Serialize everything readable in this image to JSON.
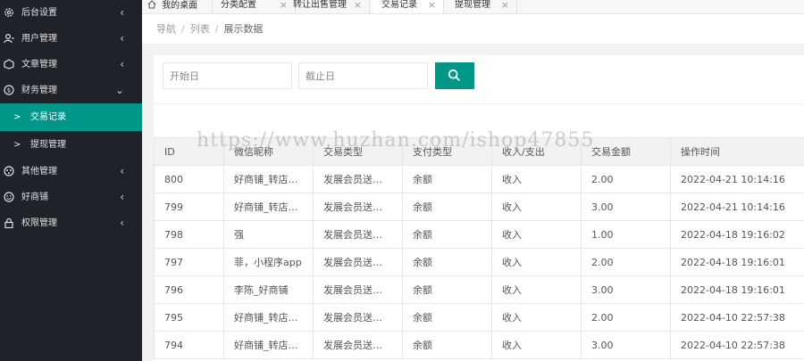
{
  "sidebar": {
    "items": [
      {
        "label": "后台设置",
        "icon": "gear-icon",
        "arrow": "‹"
      },
      {
        "label": "用户管理",
        "icon": "user-icon",
        "arrow": "‹"
      },
      {
        "label": "文章管理",
        "icon": "article-icon",
        "arrow": "‹"
      },
      {
        "label": "财务管理",
        "icon": "finance-icon",
        "arrow": "⌄"
      },
      {
        "label": "其他管理",
        "icon": "other-icon",
        "arrow": "‹"
      },
      {
        "label": "好商铺",
        "icon": "smile-icon",
        "arrow": "‹"
      },
      {
        "label": "权限管理",
        "icon": "lock-icon",
        "arrow": "‹"
      }
    ],
    "sub_items": [
      {
        "label": "交易记录",
        "arrow": ">"
      },
      {
        "label": "提现管理",
        "arrow": ">"
      }
    ],
    "active_color": "#009688",
    "bg_color": "#20222a"
  },
  "tabs": [
    {
      "label": "我的桌面",
      "icon": "home-icon"
    },
    {
      "label": "分类配置",
      "close": "×"
    },
    {
      "label": "转让出售管理",
      "close": "×"
    },
    {
      "label": "交易记录",
      "close": "×"
    },
    {
      "label": "提现管理",
      "close": "×"
    }
  ],
  "breadcrumb": {
    "nav": "导航",
    "sep": "/",
    "list": "列表",
    "current": "展示数据"
  },
  "search": {
    "start_placeholder": "开始日",
    "end_placeholder": "截止日",
    "button_icon": "search-icon"
  },
  "table": {
    "headers": [
      "ID",
      "微信昵称",
      "交易类型",
      "支付类型",
      "收入/支出",
      "交易金额",
      "操作时间"
    ],
    "rows": [
      [
        "800",
        "好商铺_转店…",
        "发展会员送…",
        "余额",
        "收入",
        "2.00",
        "2022-04-21 10:14:16"
      ],
      [
        "799",
        "好商铺_转店…",
        "发展会员送…",
        "余额",
        "收入",
        "3.00",
        "2022-04-21 10:14:16"
      ],
      [
        "798",
        "强",
        "发展会员送…",
        "余额",
        "收入",
        "1.00",
        "2022-04-18 19:16:02"
      ],
      [
        "797",
        "菲，小程序app",
        "发展会员送…",
        "余额",
        "收入",
        "2.00",
        "2022-04-18 19:16:01"
      ],
      [
        "796",
        "李陈_好商铺",
        "发展会员送…",
        "余额",
        "收入",
        "3.00",
        "2022-04-18 19:16:01"
      ],
      [
        "795",
        "好商铺_转店…",
        "发展会员送…",
        "余额",
        "收入",
        "2.00",
        "2022-04-10 22:57:38"
      ],
      [
        "794",
        "好商铺_转店…",
        "发展会员送…",
        "余额",
        "收入",
        "3.00",
        "2022-04-10 22:57:38"
      ]
    ]
  },
  "watermark": "https://www.huzhan.com/ishop47855"
}
